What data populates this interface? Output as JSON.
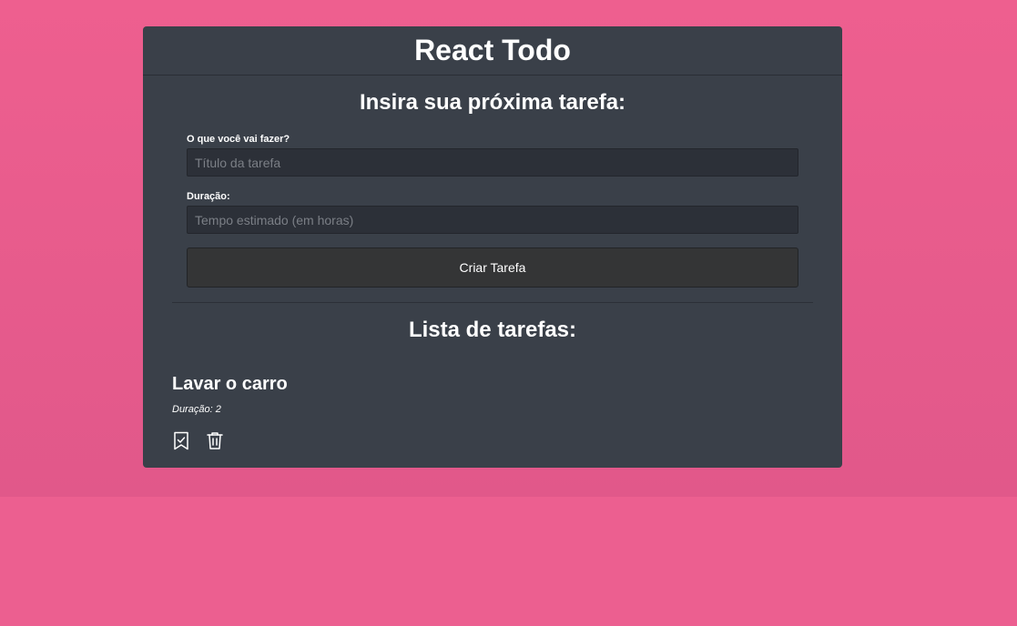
{
  "header": {
    "title": "React Todo"
  },
  "form": {
    "heading": "Insira sua próxima tarefa:",
    "title_field": {
      "label": "O que você vai fazer?",
      "placeholder": "Título da tarefa",
      "value": ""
    },
    "duration_field": {
      "label": "Duração:",
      "placeholder": "Tempo estimado (em horas)",
      "value": ""
    },
    "submit_label": "Criar Tarefa"
  },
  "list": {
    "heading": "Lista de tarefas:",
    "tasks": [
      {
        "title": "Lavar o carro",
        "duration": "Duração: 2",
        "actions": [
          "bookmark-check-icon",
          "trash-icon"
        ]
      }
    ]
  },
  "colors": {
    "background": "#ec5f90",
    "card": "#3a4049",
    "input": "#2c3038",
    "button": "#343536",
    "text": "#ffffff"
  }
}
